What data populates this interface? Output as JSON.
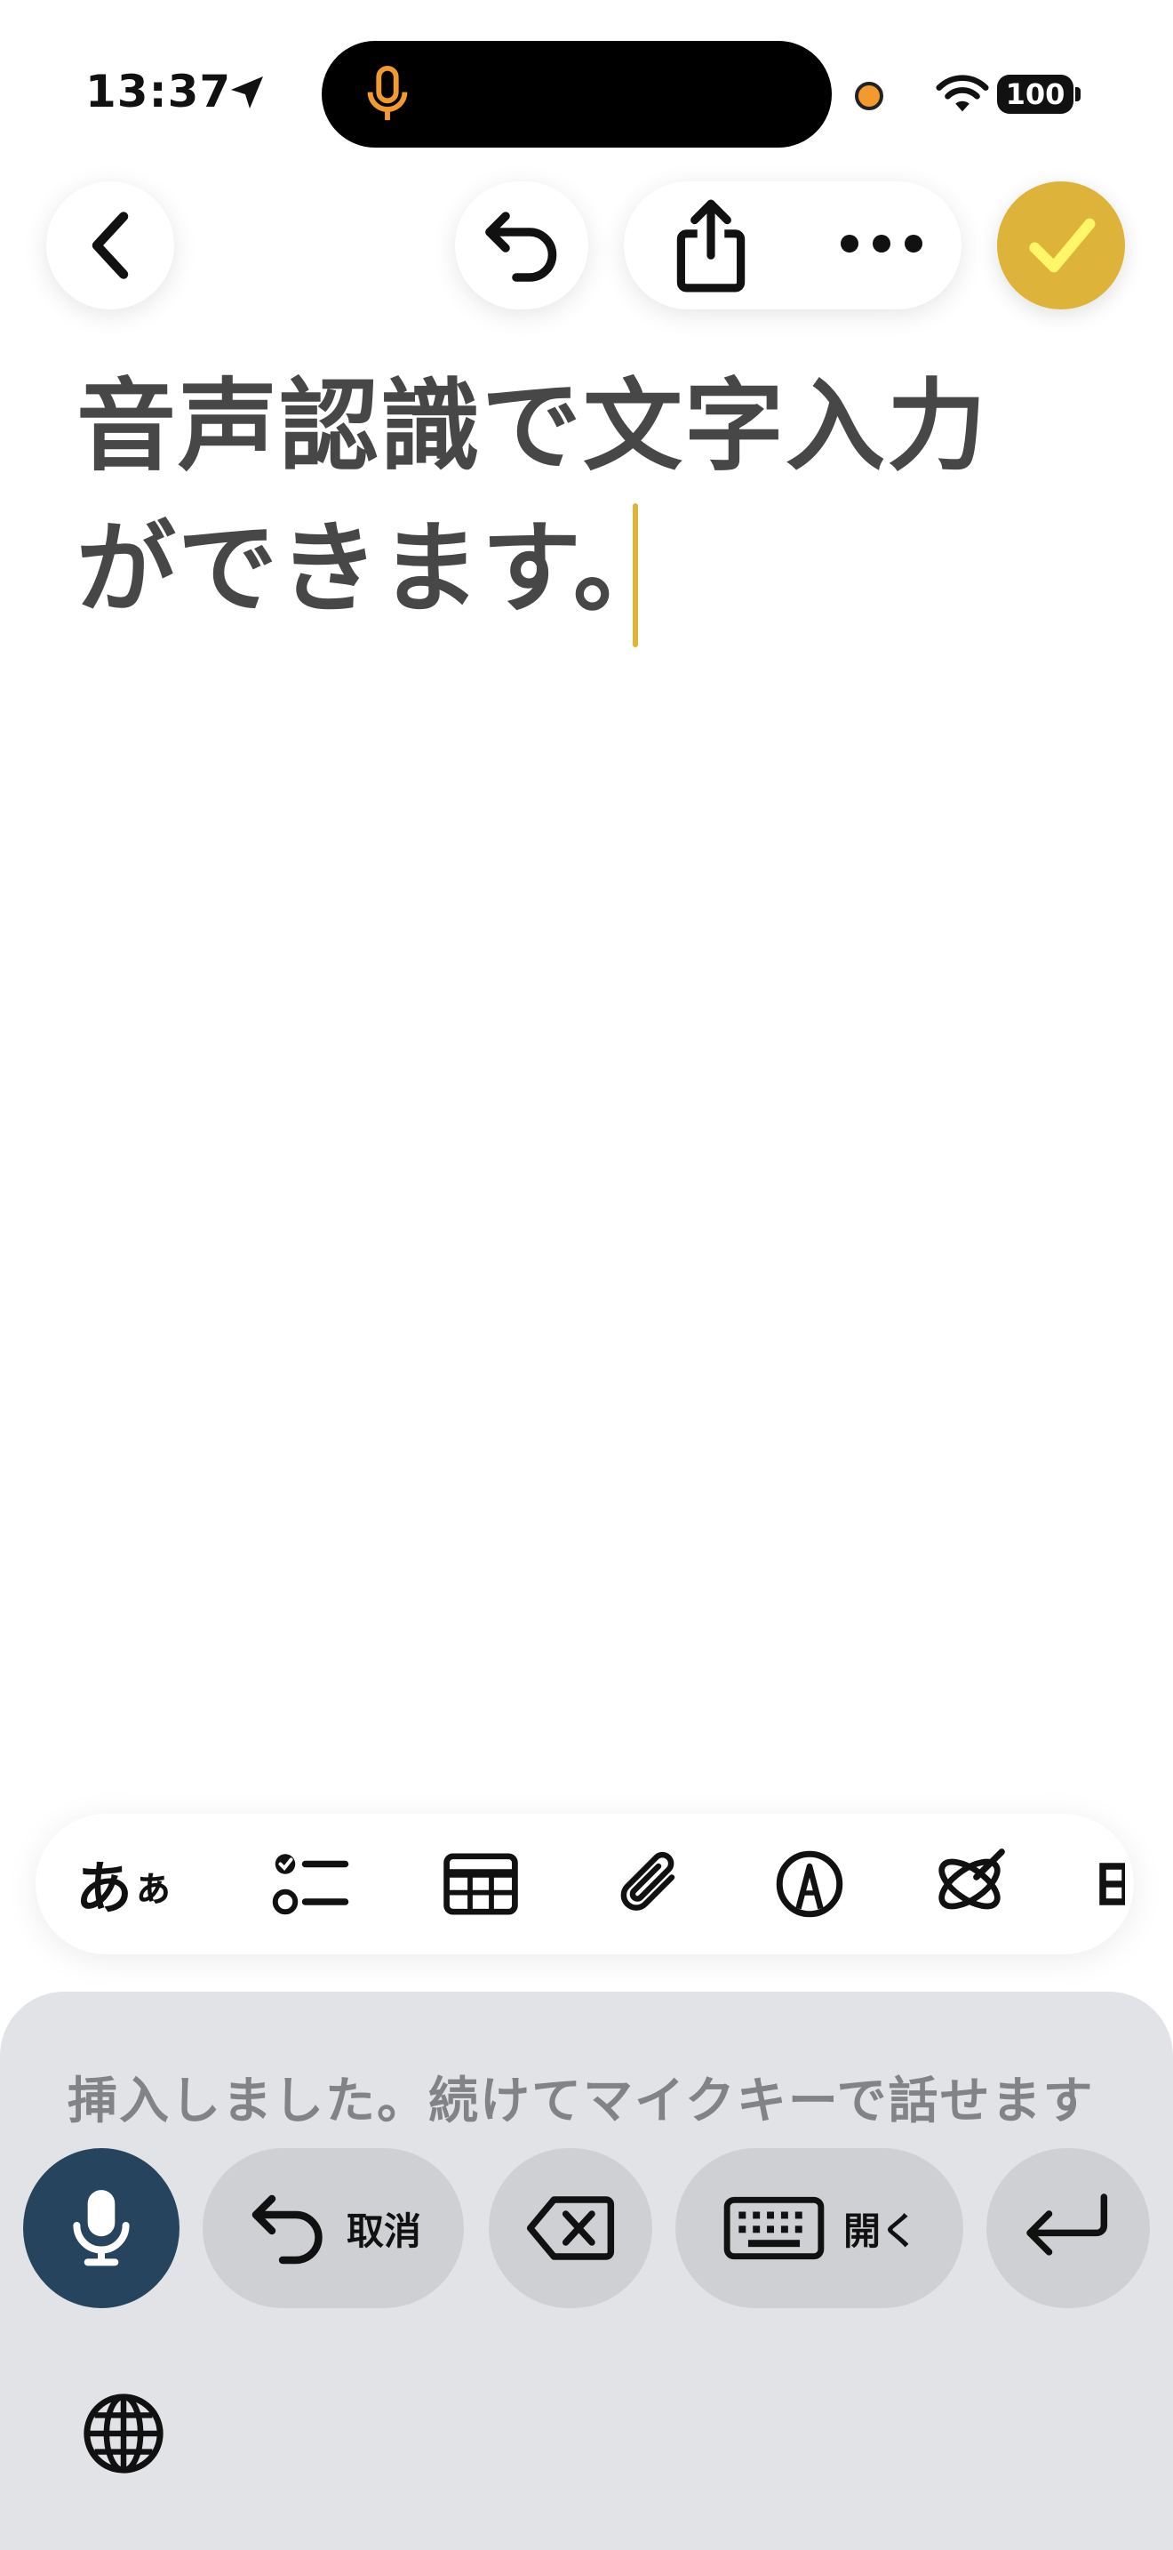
{
  "status_bar": {
    "time": "13:37",
    "battery": "100"
  },
  "toolbar": {
    "back_icon": "chevron-left-icon",
    "undo_icon": "undo-arrow-icon",
    "share_icon": "share-icon",
    "more_icon": "ellipsis-icon",
    "done_icon": "checkmark-icon",
    "done_color": "#ddb33a"
  },
  "note": {
    "text": "音声認識で文字入力\nができます。"
  },
  "format_bar": {
    "text_style_label": "あ",
    "text_style_small": "ぁ",
    "items": [
      "checklist-icon",
      "table-icon",
      "paperclip-icon",
      "markup-pen-icon",
      "apple-intelligence-icon"
    ]
  },
  "dictation": {
    "hint": "挿入しました。続けてマイクキーで話せます",
    "mic_color": "#27445e",
    "cancel_label": "取消",
    "open_label": "開く"
  }
}
